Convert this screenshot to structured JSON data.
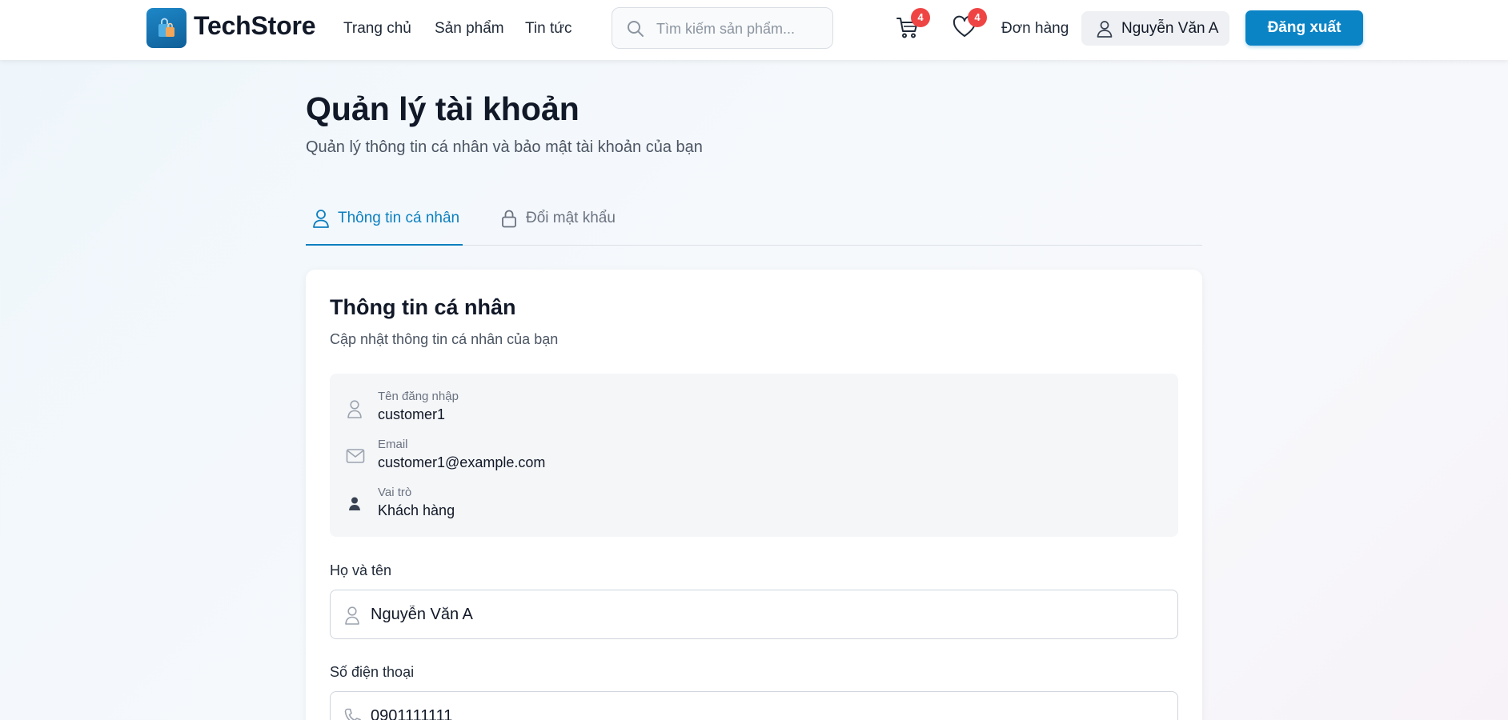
{
  "header": {
    "brand": "TechStore",
    "nav": [
      "Trang chủ",
      "Sản phẩm",
      "Tin tức"
    ],
    "search_placeholder": "Tìm kiếm sản phẩm...",
    "cart_count": "4",
    "wishlist_count": "4",
    "orders_label": "Đơn hàng",
    "user_name": "Nguyễn Văn A",
    "logout_label": "Đăng xuất",
    "accent_color": "#0b84c6",
    "badge_color": "#ef4444"
  },
  "page": {
    "title": "Quản lý tài khoản",
    "subtitle": "Quản lý thông tin cá nhân và bảo mật tài khoản của bạn"
  },
  "tabs": [
    {
      "label": "Thông tin cá nhân",
      "icon": "user-icon",
      "active": true
    },
    {
      "label": "Đổi mật khẩu",
      "icon": "lock-icon",
      "active": false
    }
  ],
  "card": {
    "title": "Thông tin cá nhân",
    "subtitle": "Cập nhật thông tin cá nhân của bạn",
    "info": [
      {
        "label": "Tên đăng nhập",
        "value": "customer1",
        "icon": "user-icon"
      },
      {
        "label": "Email",
        "value": "customer1@example.com",
        "icon": "mail-icon"
      },
      {
        "label": "Vai trò",
        "value": "Khách hàng",
        "icon": "person-filled-icon"
      }
    ],
    "fields": [
      {
        "label": "Họ và tên",
        "value": "Nguyễn Văn A",
        "icon": "user-icon"
      },
      {
        "label": "Số điện thoại",
        "value": "0901111111",
        "icon": "phone-icon"
      }
    ]
  }
}
